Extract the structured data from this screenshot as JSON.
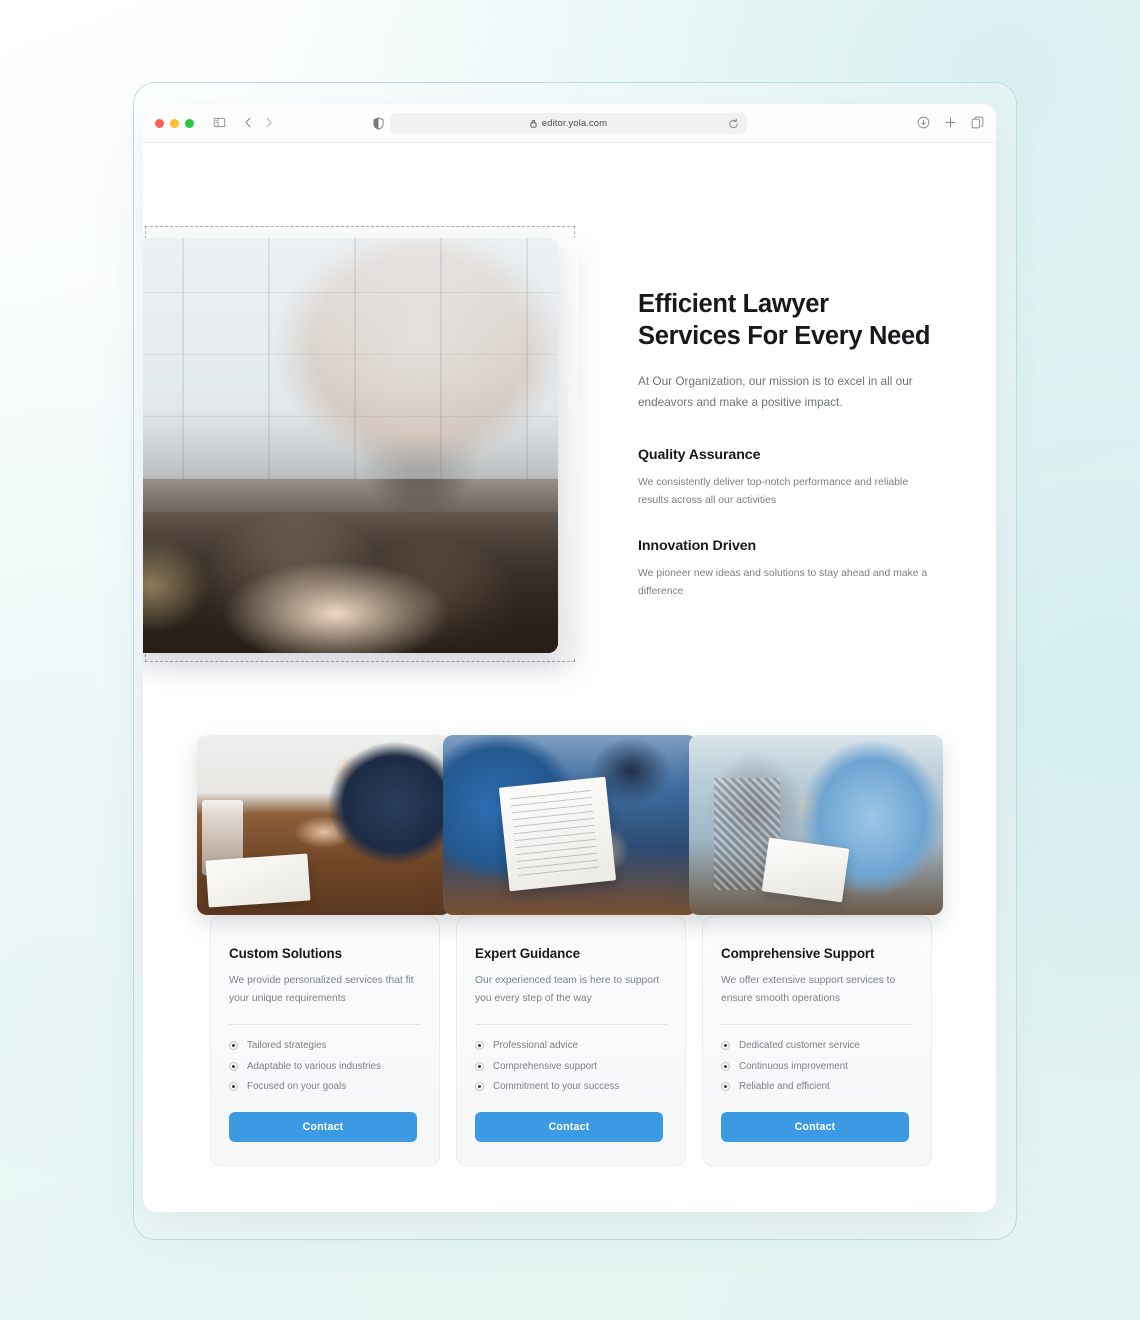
{
  "browser": {
    "traffic_lights": [
      "close",
      "minimize",
      "zoom"
    ],
    "sidebar_toggle": "sidebar-toggle-icon",
    "back": "back-arrow-icon",
    "forward": "forward-arrow-icon",
    "shield": "privacy-shield-icon",
    "lock": "lock-icon",
    "url": "editor.yola.com",
    "reload": "reload-icon",
    "download": "download-icon",
    "new_tab": "plus-icon",
    "tab_overview": "tab-overview-icon"
  },
  "hero": {
    "title": "Efficient Lawyer Services For Every Need",
    "subtitle": "At Our Organization, our mission is to excel in all our endeavors and make a positive impact.",
    "image_alt": "lawyer-meeting-photo",
    "features": [
      {
        "heading": "Quality Assurance",
        "body": "We consistently deliver top-notch performance and reliable results across all our activities"
      },
      {
        "heading": "Innovation Driven",
        "body": "We pioneer new ideas and solutions to stay ahead and make a difference"
      }
    ]
  },
  "services": {
    "cards": [
      {
        "image_alt": "lawyer-signing-documents-photo",
        "title": "Custom Solutions",
        "description": "We provide personalized services that fit your unique requirements",
        "bullets": [
          "Tailored strategies",
          "Adaptable to various industries",
          "Focused on your goals"
        ],
        "button": "Contact"
      },
      {
        "image_alt": "handing-over-contract-photo",
        "title": "Expert Guidance",
        "description": "Our experienced team is here to support you every step of the way",
        "bullets": [
          "Professional advice",
          "Comprehensive support",
          "Commitment to your success"
        ],
        "button": "Contact"
      },
      {
        "image_alt": "client-consultation-photo",
        "title": "Comprehensive Support",
        "description": "We offer extensive support services to ensure smooth operations",
        "bullets": [
          "Dedicated customer service",
          "Continuous improvement",
          "Reliable and efficient"
        ],
        "button": "Contact"
      }
    ]
  },
  "colors": {
    "accent": "#3b9ae1",
    "heading": "#17191c",
    "body_text": "#7b7f85",
    "selection_outline": "#a9a9a9",
    "frame_border": "#bcdcea"
  }
}
